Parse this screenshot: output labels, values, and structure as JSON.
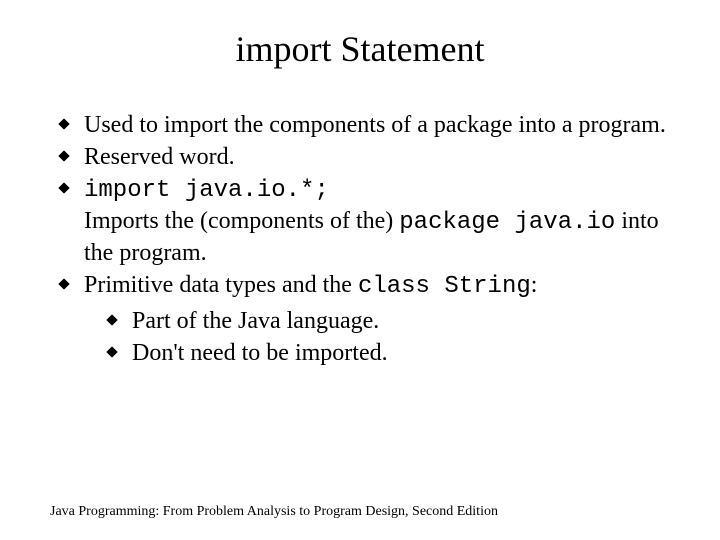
{
  "title": "import Statement",
  "bullets": {
    "b1": "Used to import the components of a package into a program.",
    "b2": "Reserved word.",
    "b3_code": "import java.io.*;",
    "b3_cont_a": "Imports the (components of the) ",
    "b3_cont_code": "package java.io",
    "b3_cont_b": " into the program.",
    "b4_a": "Primitive data types and the ",
    "b4_code": "class String",
    "b4_b": ":",
    "sub1": "Part of the Java language.",
    "sub2": "Don't need to be imported."
  },
  "footer": "Java Programming: From Problem Analysis to Program Design, Second Edition"
}
